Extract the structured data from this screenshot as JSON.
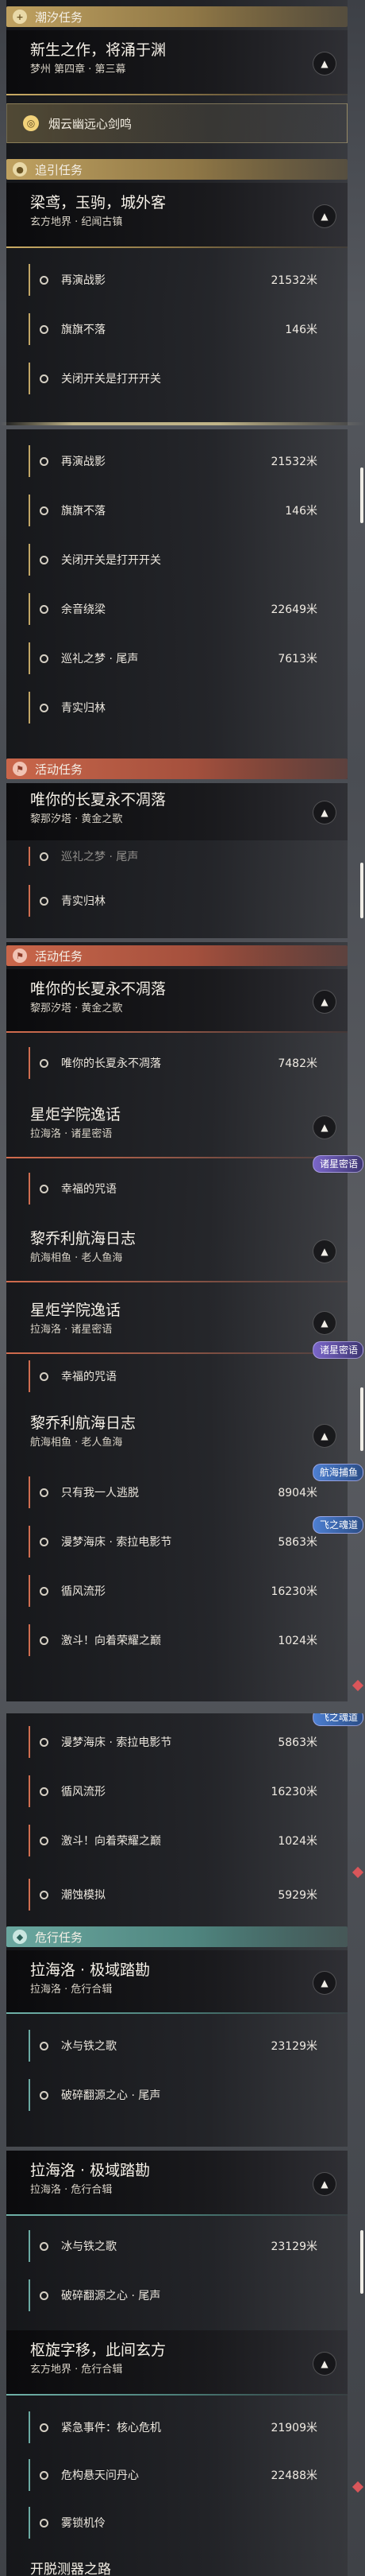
{
  "sections": {
    "tide": "潮汐任务",
    "guide": "追引任务",
    "activity": "活动任务",
    "danger": "危行任务"
  },
  "quests": {
    "tide_main": {
      "title": "新生之作，将涌于渊",
      "sub": "梦州 第四章 · 第三幕"
    },
    "tracked": {
      "name": "烟云幽远心剑鸣"
    },
    "guide_main": {
      "title": "梁鸢，玉驹，城外客",
      "sub": "玄方地界 · 纪闻古镇"
    },
    "act1": {
      "title": "唯你的长夏永不凋落",
      "sub": "黎那汐塔 · 黄金之歌"
    },
    "act2": {
      "title": "星炬学院逸话",
      "sub": "拉海洛 · 诸星密语"
    },
    "act3": {
      "title": "黎乔利航海日志",
      "sub": "航海相鱼 · 老人鱼海"
    },
    "danger1": {
      "title": "拉海洛 · 极域踏勘",
      "sub": "拉海洛 · 危行合辑"
    },
    "danger2": {
      "title": "枢旋字移，此间玄方",
      "sub": "玄方地界 · 危行合辑"
    },
    "bottom_cut": "开脱测器之路"
  },
  "objectives": {
    "replay_battle": {
      "name": "再演战影",
      "dist": "21532米"
    },
    "banner": {
      "name": "旗旗不落",
      "dist": "146米"
    },
    "switch": {
      "name": "关闭开关是打开开关"
    },
    "lingering": {
      "name": "余音绕梁",
      "dist": "22649米"
    },
    "patrol": {
      "name": "巡礼之梦 · 尾声",
      "dist": "7613米"
    },
    "green_forest": {
      "name": "青实归林"
    },
    "summer_never": {
      "name": "唯你的长夏永不凋落",
      "dist": "7482米"
    },
    "lucky_curse": {
      "name": "幸福的咒语"
    },
    "only_me": {
      "name": "只有我一人逃脱",
      "dist": "8904米"
    },
    "movie": {
      "name": "漫梦海床 · 索拉电影节",
      "dist": "5863米"
    },
    "wind": {
      "name": "循风流形",
      "dist": "16230米"
    },
    "fight": {
      "name": "激斗！向着荣耀之巅",
      "dist": "1024米"
    },
    "tide_sim": {
      "name": "潮蚀模拟",
      "dist": "5929米"
    },
    "ice_iron": {
      "name": "冰与铁之歌",
      "dist": "23129米"
    },
    "broken_core": {
      "name": "破碎翻源之心 · 尾声"
    },
    "emergency": {
      "name": "紧急事件：核心危机",
      "dist": "21909米"
    },
    "hanging_heart": {
      "name": "危构悬天问丹心",
      "dist": "22488米"
    },
    "mist": {
      "name": "雾锁机伶"
    }
  },
  "tags": {
    "stars": "诸星密语",
    "sail": "航海捕鱼",
    "flying": "飞之魂道"
  },
  "icons": {
    "header_tide": "plus-icon",
    "header_guide": "location-pin-icon",
    "header_activity": "flag-icon",
    "header_danger": "hazard-icon",
    "expand": "chevron-up-icon",
    "objective": "circle-marker-icon"
  },
  "colors": {
    "gold": "#c1a566",
    "red": "#cf6d50",
    "teal": "#6aaaa2"
  }
}
